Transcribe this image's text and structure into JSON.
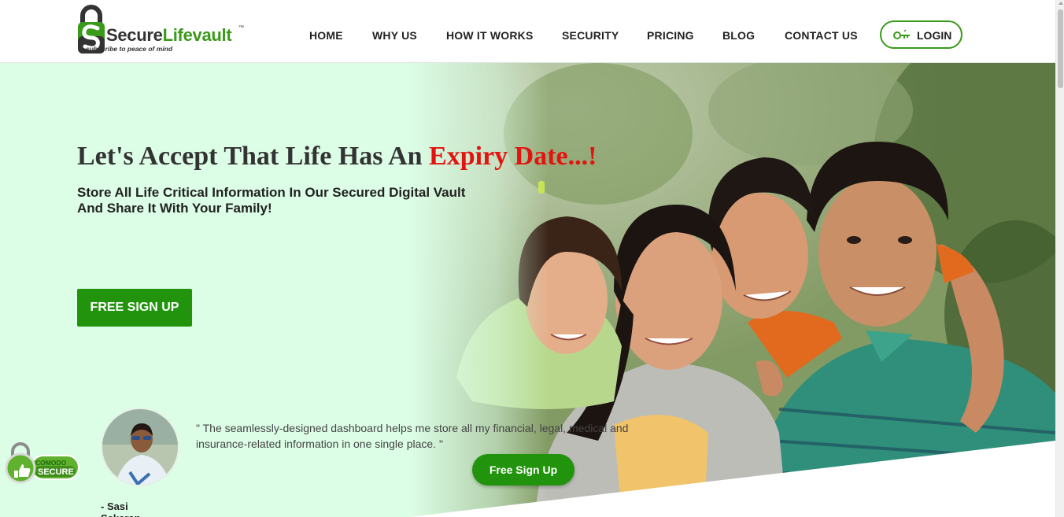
{
  "brand": {
    "name_part1": "Secure",
    "name_part2": "Lifevault",
    "trademark": "™",
    "tagline": "subscribe to peace of mind",
    "primary_color": "#3a9a1a",
    "accent_color": "#e3140f"
  },
  "nav": {
    "items": [
      "HOME",
      "WHY US",
      "HOW IT WORKS",
      "SECURITY",
      "PRICING",
      "BLOG",
      "CONTACT US"
    ],
    "login": {
      "label": "LOGIN",
      "icon": "key-icon"
    }
  },
  "hero": {
    "headline_part1": "Let's Accept That Life Has An ",
    "headline_accent": "Expiry Date...!",
    "subline_line1": "Store All Life Critical Information In Our Secured Digital Vault",
    "subline_line2": "And Share It With Your Family!",
    "cta_label": "FREE SIGN UP",
    "photo": "family-photo"
  },
  "testimonial": {
    "quote_line1": "\" The seamlessly-designed dashboard helps me store all my financial, legal, medical and",
    "quote_line2": "insurance-related information in one single place. \"",
    "author": "- Sasi Sekaran",
    "cta_label": "Free Sign Up"
  },
  "badge": {
    "line1": "COMODO",
    "line2": "SECURE"
  }
}
